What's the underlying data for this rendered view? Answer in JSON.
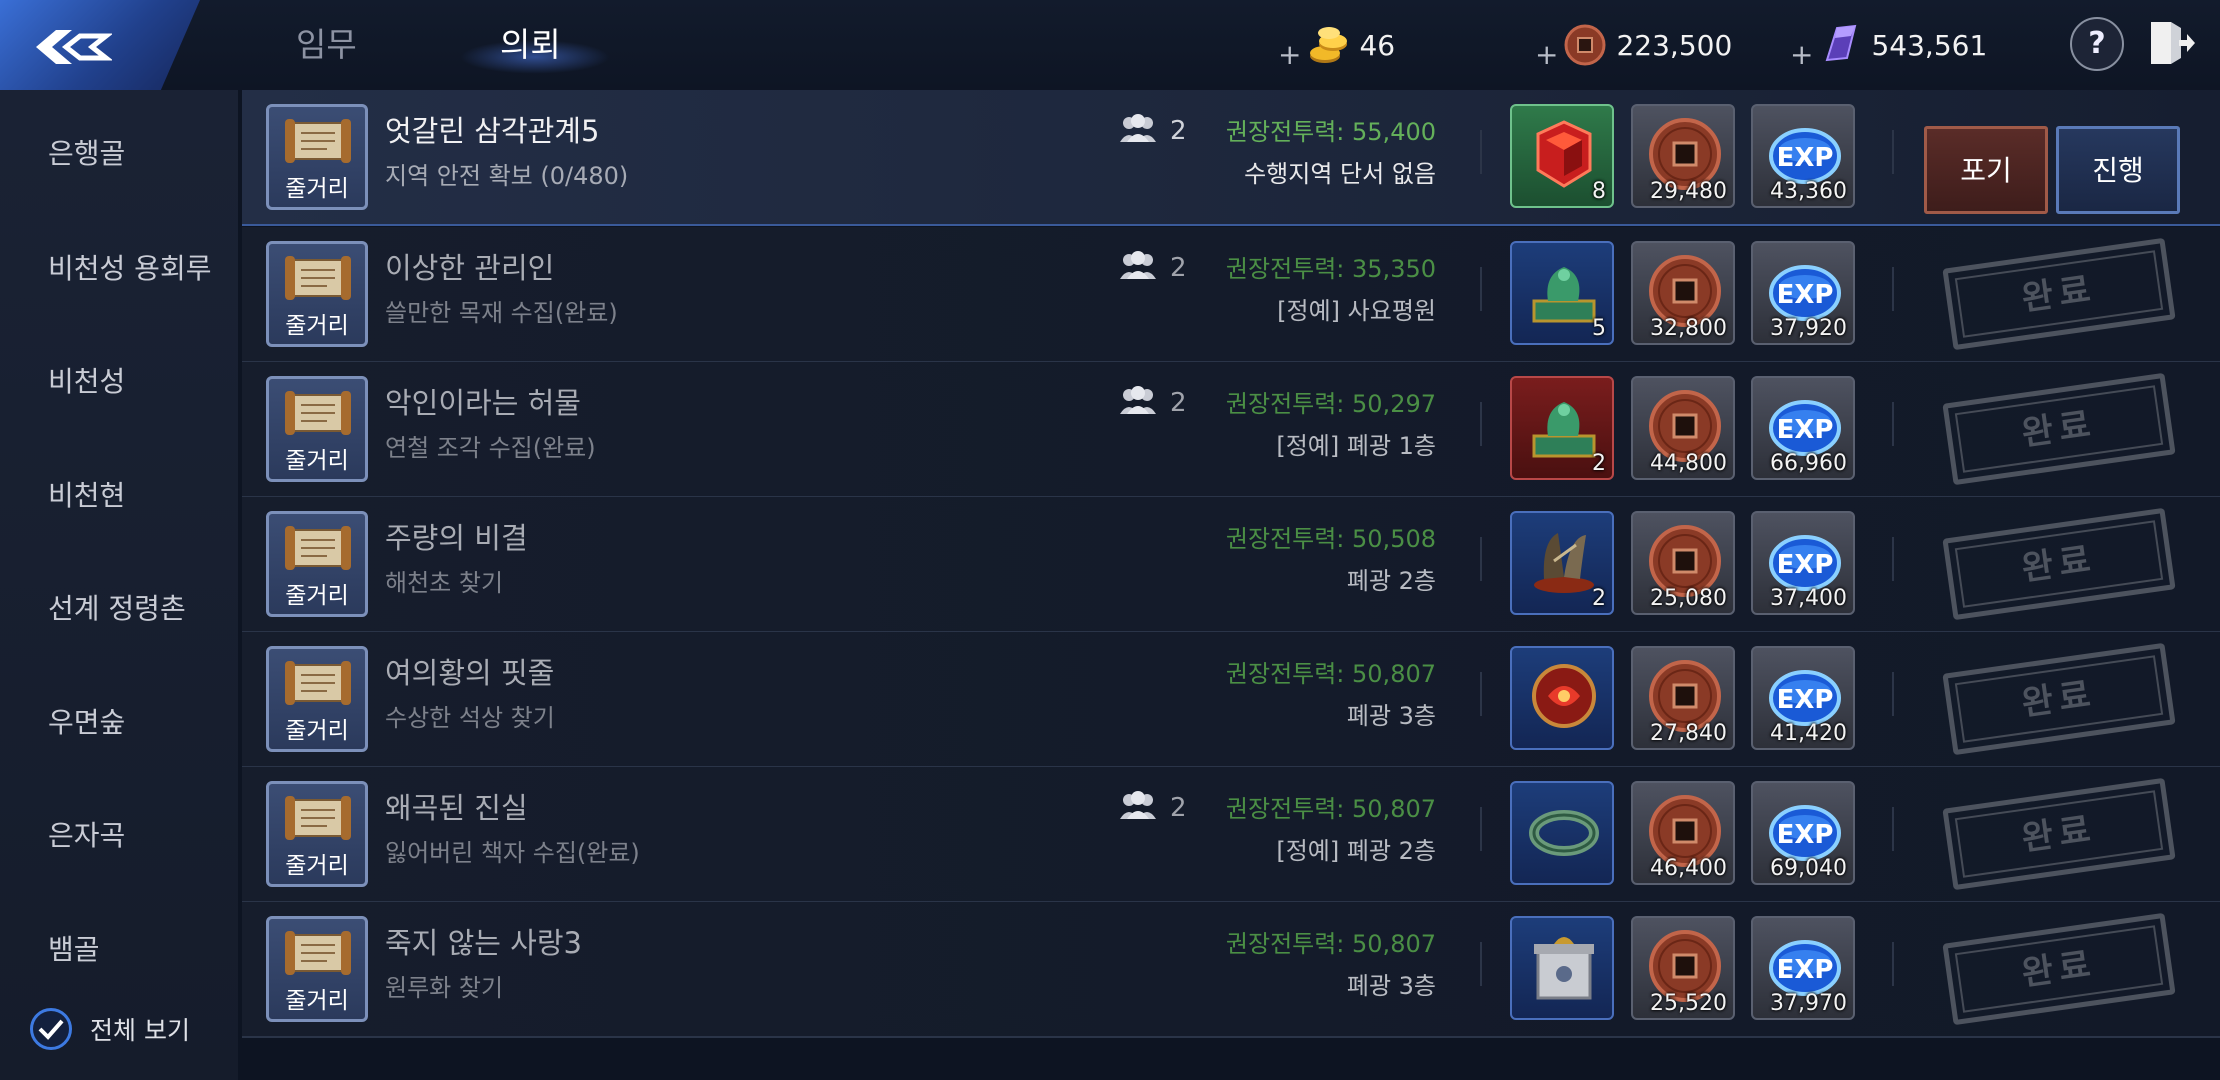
{
  "header": {
    "tabs": [
      {
        "label": "임무",
        "active": false
      },
      {
        "label": "의뢰",
        "active": true
      }
    ],
    "currencies": [
      {
        "icon": "gold-coin-icon",
        "plus": "+",
        "value": "46"
      },
      {
        "icon": "copper-coin-icon",
        "plus": "+",
        "value": "223,500"
      },
      {
        "icon": "purple-crystal-icon",
        "plus": "+",
        "value": "543,561"
      }
    ],
    "help_label": "?"
  },
  "sidebar": {
    "items": [
      {
        "label": "은행골"
      },
      {
        "label": "비천성 용회루"
      },
      {
        "label": "비천성"
      },
      {
        "label": "비천현"
      },
      {
        "label": "선계 정령촌"
      },
      {
        "label": "우면숲"
      },
      {
        "label": "은자곡"
      },
      {
        "label": "뱀골"
      }
    ],
    "view_all_label": "전체 보기",
    "view_all_checked": true
  },
  "quests": [
    {
      "type_label": "줄거리",
      "title": "엇갈린 삼각관계5",
      "subtitle": "지역 안전 확보 (0/480)",
      "party": "2",
      "power": "권장전투력: 55,400",
      "location": "수행지역 단서 없음",
      "status": "active",
      "rewards": [
        {
          "icon": "red-gem-icon",
          "count": "8",
          "bg": "green"
        },
        {
          "icon": "copper-coin-icon",
          "count": "29,480"
        },
        {
          "icon": "exp-icon",
          "count": "43,360"
        }
      ],
      "giveup_label": "포기",
      "progress_label": "진행"
    },
    {
      "type_label": "줄거리",
      "title": "이상한 관리인",
      "subtitle": "쓸만한 목재 수집(완료)",
      "party": "2",
      "power": "권장전투력: 35,350",
      "location": "[정예] 사요평원",
      "status": "done",
      "rewards": [
        {
          "icon": "jade-seal-icon",
          "count": "5",
          "bg": "blue"
        },
        {
          "icon": "copper-coin-icon",
          "count": "32,800"
        },
        {
          "icon": "exp-icon",
          "count": "37,920"
        }
      ],
      "stamp_label": "완료"
    },
    {
      "type_label": "줄거리",
      "title": "악인이라는 허물",
      "subtitle": "연철 조각 수집(완료)",
      "party": "2",
      "power": "권장전투력: 50,297",
      "location": "[정예] 폐광 1층",
      "status": "done",
      "rewards": [
        {
          "icon": "jade-seal-icon",
          "count": "2",
          "bg": "red"
        },
        {
          "icon": "copper-coin-icon",
          "count": "44,800"
        },
        {
          "icon": "exp-icon",
          "count": "66,960"
        }
      ],
      "stamp_label": "완료"
    },
    {
      "type_label": "줄거리",
      "title": "주량의 비결",
      "subtitle": "해천초 찾기",
      "party": "",
      "power": "권장전투력: 50,508",
      "location": "폐광 2층",
      "status": "done",
      "rewards": [
        {
          "icon": "claw-relic-icon",
          "count": "2",
          "bg": "blue"
        },
        {
          "icon": "copper-coin-icon",
          "count": "25,080"
        },
        {
          "icon": "exp-icon",
          "count": "37,400"
        }
      ],
      "stamp_label": "완료"
    },
    {
      "type_label": "줄거리",
      "title": "여의황의 핏줄",
      "subtitle": "수상한 석상 찾기",
      "party": "",
      "power": "권장전투력: 50,807",
      "location": "폐광 3층",
      "status": "done",
      "rewards": [
        {
          "icon": "red-orb-icon",
          "count": "",
          "bg": "blue"
        },
        {
          "icon": "copper-coin-icon",
          "count": "27,840"
        },
        {
          "icon": "exp-icon",
          "count": "41,420"
        }
      ],
      "stamp_label": "완료"
    },
    {
      "type_label": "줄거리",
      "title": "왜곡된 진실",
      "subtitle": "잃어버린 책자 수집(완료)",
      "party": "2",
      "power": "권장전투력: 50,807",
      "location": "[정예] 폐광 2층",
      "status": "done",
      "rewards": [
        {
          "icon": "jade-ring-icon",
          "count": "",
          "bg": "blue"
        },
        {
          "icon": "copper-coin-icon",
          "count": "46,400"
        },
        {
          "icon": "exp-icon",
          "count": "69,040"
        }
      ],
      "stamp_label": "완료"
    },
    {
      "type_label": "줄거리",
      "title": "죽지 않는 사랑3",
      "subtitle": "원루화 찾기",
      "party": "",
      "power": "권장전투력: 50,807",
      "location": "폐광 3층",
      "status": "done",
      "rewards": [
        {
          "icon": "silver-box-icon",
          "count": "",
          "bg": "blue"
        },
        {
          "icon": "copper-coin-icon",
          "count": "25,520"
        },
        {
          "icon": "exp-icon",
          "count": "37,970"
        }
      ],
      "stamp_label": "완료"
    }
  ]
}
